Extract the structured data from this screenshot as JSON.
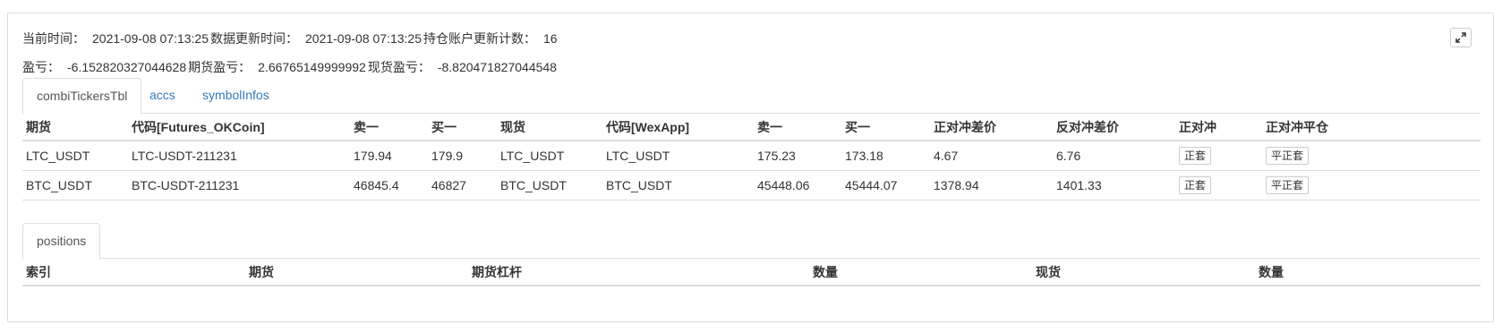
{
  "info": {
    "current_time_label": "当前时间：",
    "current_time": "2021-09-08 07:13:25",
    "update_time_label": "数据更新时间：",
    "update_time": "2021-09-08 07:13:25",
    "position_count_label": "持仓账户更新计数：",
    "position_count": "16",
    "pnl_label": "盈亏：",
    "pnl": "-6.152820327044628",
    "futures_pnl_label": "期货盈亏：",
    "futures_pnl": "2.66765149999992",
    "spot_pnl_label": "现货盈亏：",
    "spot_pnl": "-8.820471827044548"
  },
  "expand_icon": "expand-arrows-icon",
  "tabs1": [
    {
      "label": "combiTickersTbl",
      "active": true
    },
    {
      "label": "accs",
      "active": false
    },
    {
      "label": "symbolInfos",
      "active": false
    }
  ],
  "tickers": {
    "headers": [
      "期货",
      "代码[Futures_OKCoin]",
      "卖一",
      "买一",
      "现货",
      "代码[WexApp]",
      "卖一",
      "买一",
      "正对冲差价",
      "反对冲差价",
      "正对冲",
      "正对冲平仓"
    ],
    "rows": [
      {
        "futures": "LTC_USDT",
        "futures_code": "LTC-USDT-211231",
        "f_ask": "179.94",
        "f_bid": "179.9",
        "spot": "LTC_USDT",
        "spot_code": "LTC_USDT",
        "s_ask": "175.23",
        "s_bid": "173.18",
        "pos_spread": "4.67",
        "neg_spread": "6.76",
        "hedge_btn": "正套",
        "close_btn": "平正套"
      },
      {
        "futures": "BTC_USDT",
        "futures_code": "BTC-USDT-211231",
        "f_ask": "46845.4",
        "f_bid": "46827",
        "spot": "BTC_USDT",
        "spot_code": "BTC_USDT",
        "s_ask": "45448.06",
        "s_bid": "45444.07",
        "pos_spread": "1378.94",
        "neg_spread": "1401.33",
        "hedge_btn": "正套",
        "close_btn": "平正套"
      }
    ]
  },
  "tabs2": [
    {
      "label": "positions",
      "active": true
    }
  ],
  "positions": {
    "headers": [
      "索引",
      "期货",
      "期货杠杆",
      "数量",
      "现货",
      "数量"
    ]
  }
}
